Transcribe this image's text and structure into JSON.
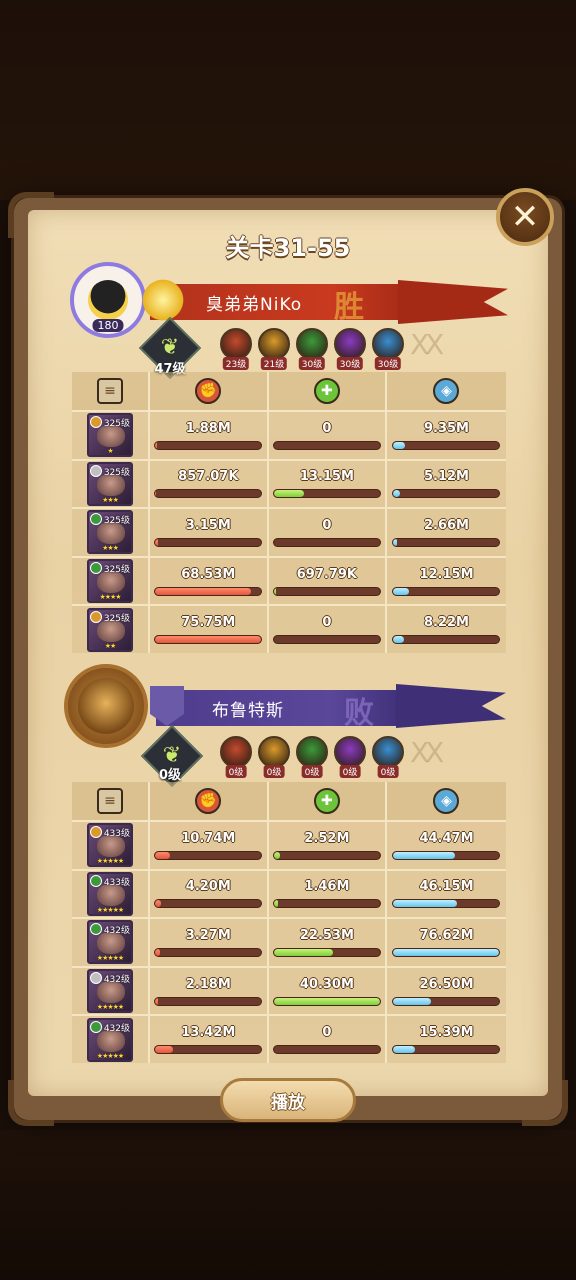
{
  "title": "关卡31-55",
  "close_label": "✕",
  "play_label": "播放",
  "colors": {
    "damage": "#e2563f",
    "heal": "#7ccf3a",
    "tank": "#64c4ea",
    "win_banner": "#c93a1f",
    "lose_banner": "#5a479a"
  },
  "column_icons": [
    "scroll-icon",
    "fist-damage-icon",
    "heal-cross-icon",
    "shield-icon"
  ],
  "teams": [
    {
      "name": "臭弟弟NiKo",
      "result": "胜",
      "avatar_level": "180",
      "rank_level": "47级",
      "factions": [
        {
          "icon": "fire-faction-icon",
          "level": "23级",
          "color": "#c24a2e"
        },
        {
          "icon": "light-faction-icon",
          "level": "21级",
          "color": "#d99a2b"
        },
        {
          "icon": "forest-faction-icon",
          "level": "30级",
          "color": "#3c9a3a"
        },
        {
          "icon": "void-faction-icon",
          "level": "30级",
          "color": "#8a3cc0"
        },
        {
          "icon": "ice-faction-icon",
          "level": "30级",
          "color": "#3a8ed0"
        }
      ],
      "heroes": [
        {
          "level": "325级",
          "stars": "★",
          "faction": "#d99a2b",
          "damage": "1.88M",
          "heal": "0",
          "tank": "9.35M"
        },
        {
          "level": "325级",
          "stars": "★★★",
          "faction": "#c0c0c0",
          "damage": "857.07K",
          "heal": "13.15M",
          "tank": "5.12M"
        },
        {
          "level": "325级",
          "stars": "★★★",
          "faction": "#3c9a3a",
          "damage": "3.15M",
          "heal": "0",
          "tank": "2.66M"
        },
        {
          "level": "325级",
          "stars": "★★★★",
          "faction": "#3c9a3a",
          "damage": "68.53M",
          "heal": "697.79K",
          "tank": "12.15M"
        },
        {
          "level": "325级",
          "stars": "★★",
          "faction": "#d99a2b",
          "damage": "75.75M",
          "heal": "0",
          "tank": "8.22M"
        }
      ],
      "bars": [
        {
          "damage": 0.02,
          "heal": 0,
          "tank": 0.11
        },
        {
          "damage": 0.01,
          "heal": 0.28,
          "tank": 0.06
        },
        {
          "damage": 0.03,
          "heal": 0,
          "tank": 0.03
        },
        {
          "damage": 0.9,
          "heal": 0.02,
          "tank": 0.15
        },
        {
          "damage": 1.0,
          "heal": 0,
          "tank": 0.1
        }
      ]
    },
    {
      "name": "布鲁特斯",
      "result": "败",
      "rank_level": "0级",
      "factions": [
        {
          "icon": "fire-faction-icon",
          "level": "0级",
          "color": "#c24a2e"
        },
        {
          "icon": "light-faction-icon",
          "level": "0级",
          "color": "#d99a2b"
        },
        {
          "icon": "forest-faction-icon",
          "level": "0级",
          "color": "#3c9a3a"
        },
        {
          "icon": "void-faction-icon",
          "level": "0级",
          "color": "#8a3cc0"
        },
        {
          "icon": "ice-faction-icon",
          "level": "0级",
          "color": "#3a8ed0"
        }
      ],
      "heroes": [
        {
          "level": "433级",
          "stars": "★★★★★",
          "faction": "#d99a2b",
          "damage": "10.74M",
          "heal": "2.52M",
          "tank": "44.47M"
        },
        {
          "level": "433级",
          "stars": "★★★★★",
          "faction": "#3c9a3a",
          "damage": "4.20M",
          "heal": "1.46M",
          "tank": "46.15M"
        },
        {
          "level": "432级",
          "stars": "★★★★★",
          "faction": "#3c9a3a",
          "damage": "3.27M",
          "heal": "22.53M",
          "tank": "76.62M"
        },
        {
          "level": "432级",
          "stars": "★★★★★",
          "faction": "#c0c0c0",
          "damage": "2.18M",
          "heal": "40.30M",
          "tank": "26.50M"
        },
        {
          "level": "432级",
          "stars": "★★★★★",
          "faction": "#3c9a3a",
          "damage": "13.42M",
          "heal": "0",
          "tank": "15.39M"
        }
      ],
      "bars": [
        {
          "damage": 0.14,
          "heal": 0.06,
          "tank": 0.58
        },
        {
          "damage": 0.05,
          "heal": 0.04,
          "tank": 0.6
        },
        {
          "damage": 0.04,
          "heal": 0.56,
          "tank": 1.0
        },
        {
          "damage": 0.03,
          "heal": 1.0,
          "tank": 0.35
        },
        {
          "damage": 0.17,
          "heal": 0,
          "tank": 0.2
        }
      ]
    }
  ]
}
